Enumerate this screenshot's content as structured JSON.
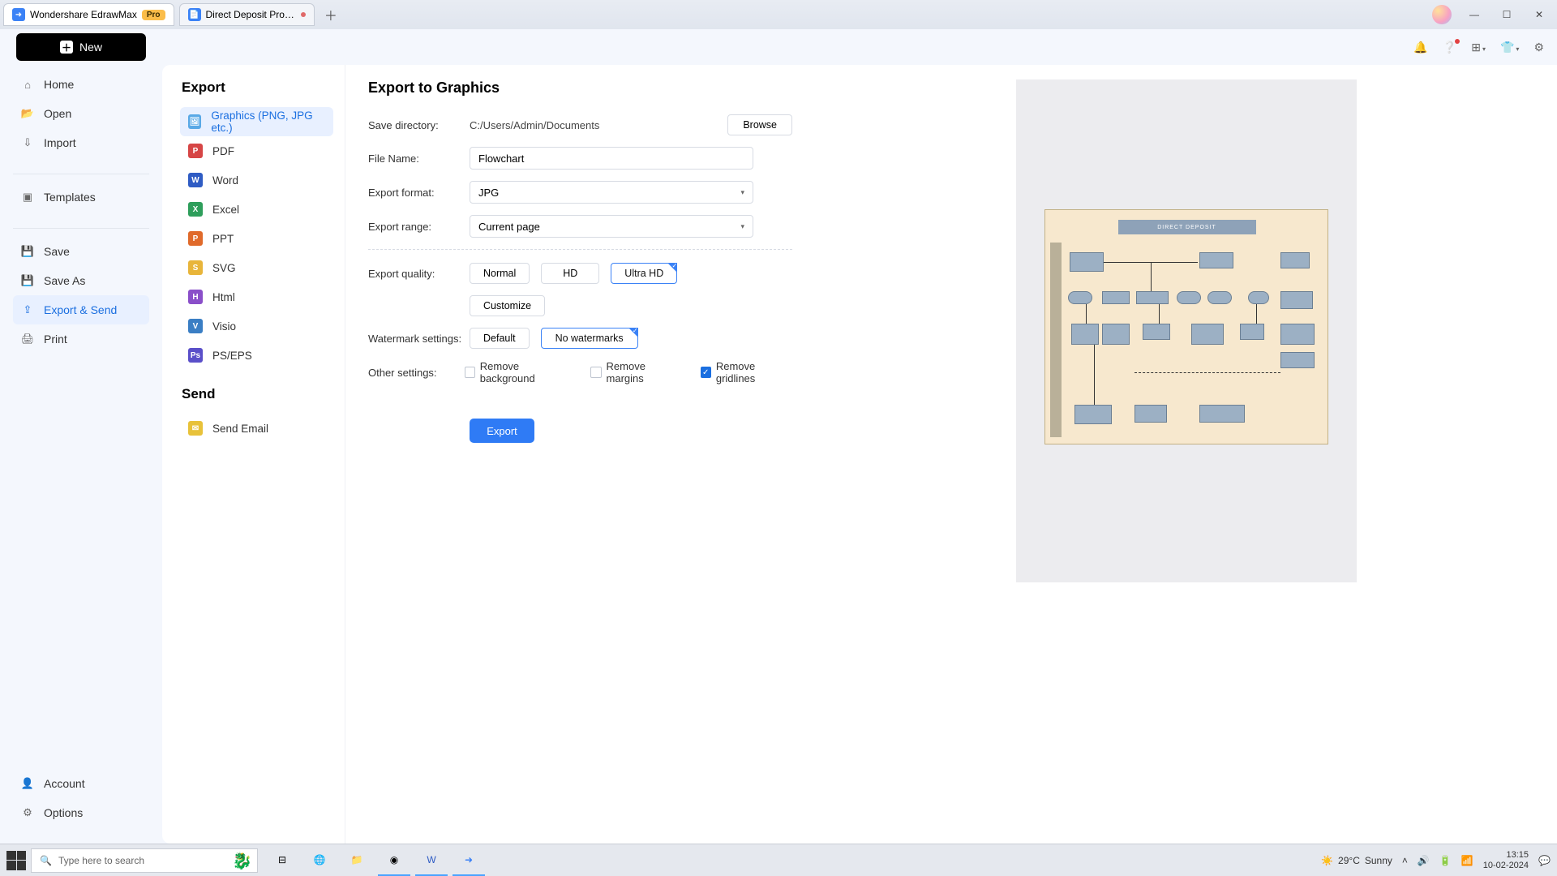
{
  "titlebar": {
    "tabs": [
      {
        "label": "Wondershare EdrawMax",
        "badge": "Pro",
        "icon_bg": "#3b82f6",
        "icon_glyph": "➜"
      },
      {
        "label": "Direct Deposit Pro…",
        "modified": true,
        "icon_bg": "#3b82f6",
        "icon_glyph": "📄"
      }
    ]
  },
  "toprow": {
    "new_label": "New"
  },
  "leftnav": {
    "group1": [
      {
        "key": "home",
        "label": "Home",
        "icon": "⌂"
      },
      {
        "key": "open",
        "label": "Open",
        "icon": "📂"
      },
      {
        "key": "import",
        "label": "Import",
        "icon": "⇩"
      }
    ],
    "group2": [
      {
        "key": "templates",
        "label": "Templates",
        "icon": "▣"
      }
    ],
    "group3": [
      {
        "key": "save",
        "label": "Save",
        "icon": "💾"
      },
      {
        "key": "saveas",
        "label": "Save As",
        "icon": "💾"
      },
      {
        "key": "exportsend",
        "label": "Export & Send",
        "icon": "⇪",
        "active": true
      },
      {
        "key": "print",
        "label": "Print",
        "icon": "🖨"
      }
    ],
    "bottom": [
      {
        "key": "account",
        "label": "Account",
        "icon": "👤"
      },
      {
        "key": "options",
        "label": "Options",
        "icon": "⚙"
      }
    ]
  },
  "exportcol": {
    "heading_export": "Export",
    "heading_send": "Send",
    "items": [
      {
        "key": "graphics",
        "label": "Graphics (PNG, JPG etc.)",
        "color": "#5aa9e6",
        "glyph": "🖼",
        "active": true
      },
      {
        "key": "pdf",
        "label": "PDF",
        "color": "#d64545",
        "glyph": "P"
      },
      {
        "key": "word",
        "label": "Word",
        "color": "#2f5cc4",
        "glyph": "W"
      },
      {
        "key": "excel",
        "label": "Excel",
        "color": "#2e9e5b",
        "glyph": "X"
      },
      {
        "key": "ppt",
        "label": "PPT",
        "color": "#e06a2b",
        "glyph": "P"
      },
      {
        "key": "svg",
        "label": "SVG",
        "color": "#e8b53a",
        "glyph": "S"
      },
      {
        "key": "html",
        "label": "Html",
        "color": "#8a4fc9",
        "glyph": "H"
      },
      {
        "key": "visio",
        "label": "Visio",
        "color": "#3a7ec4",
        "glyph": "V"
      },
      {
        "key": "pseps",
        "label": "PS/EPS",
        "color": "#5a4fc9",
        "glyph": "Ps"
      }
    ],
    "send_items": [
      {
        "key": "email",
        "label": "Send Email",
        "color": "#e8c23a",
        "glyph": "✉"
      }
    ]
  },
  "settings": {
    "heading": "Export to Graphics",
    "save_dir_label": "Save directory:",
    "save_dir_value": "C:/Users/Admin/Documents",
    "browse_label": "Browse",
    "file_name_label": "File Name:",
    "file_name_value": "Flowchart",
    "format_label": "Export format:",
    "format_value": "JPG",
    "range_label": "Export range:",
    "range_value": "Current page",
    "quality_label": "Export quality:",
    "quality_options": [
      "Normal",
      "HD",
      "Ultra HD"
    ],
    "quality_selected": "Ultra HD",
    "customize_label": "Customize",
    "watermark_label": "Watermark settings:",
    "watermark_options": [
      "Default",
      "No watermarks"
    ],
    "watermark_selected": "No watermarks",
    "other_label": "Other settings:",
    "checks": [
      {
        "key": "bg",
        "label": "Remove background",
        "checked": false
      },
      {
        "key": "margins",
        "label": "Remove margins",
        "checked": false
      },
      {
        "key": "gridlines",
        "label": "Remove gridlines",
        "checked": true
      }
    ],
    "export_btn": "Export"
  },
  "preview": {
    "diagram_title": "DIRECT DEPOSIT"
  },
  "taskbar": {
    "search_placeholder": "Type here to search",
    "weather_temp": "29°C",
    "weather_desc": "Sunny",
    "time": "13:15",
    "date": "10-02-2024"
  }
}
